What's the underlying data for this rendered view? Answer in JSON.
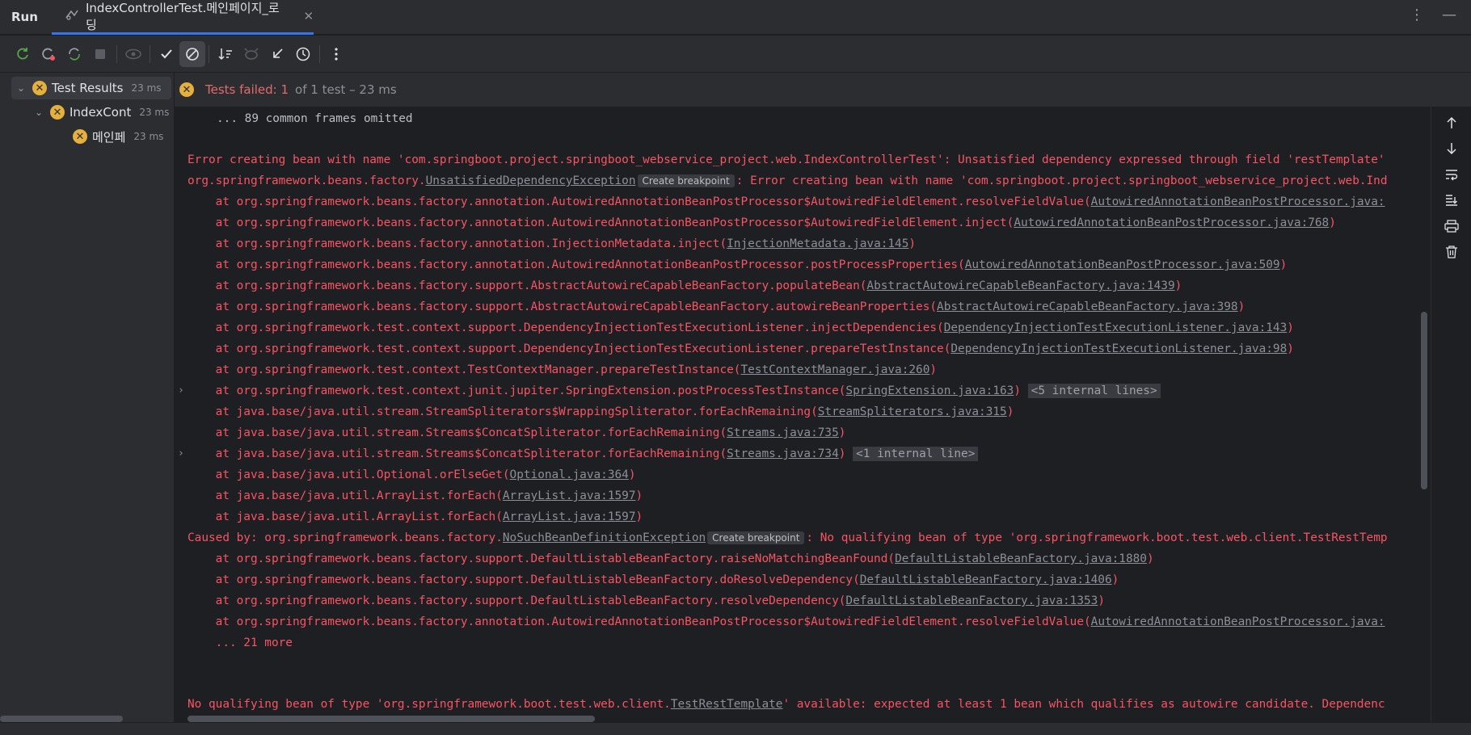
{
  "titlebar": {
    "run_label": "Run",
    "tab_title": "IndexControllerTest.메인페이지_로딩",
    "tab_close": "✕",
    "more": "⋮",
    "minimize": "—"
  },
  "tree": {
    "root": {
      "label": "Test Results",
      "duration": "23 ms"
    },
    "class_node": {
      "label": "IndexCont",
      "duration": "23 ms"
    },
    "method_node": {
      "label": "메인페",
      "duration": "23 ms"
    }
  },
  "summary": {
    "failed_label": "Tests failed: 1",
    "rest_label": "of 1 test – 23 ms"
  },
  "console": {
    "l0": "... 89 common frames omitted",
    "l1": "Error creating bean with name 'com.springboot.project.springboot_webservice_project.web.IndexControllerTest': Unsatisfied dependency expressed through field 'restTemplate'",
    "l2a": "org.springframework.beans.factory.",
    "l2link": "UnsatisfiedDependencyException",
    "l2badge": "Create breakpoint",
    "l2b": ": Error creating bean with name 'com.springboot.project.springboot_webservice_project.web.Ind",
    "l3a": "    at org.springframework.beans.factory.annotation.AutowiredAnnotationBeanPostProcessor$AutowiredFieldElement.resolveFieldValue(",
    "l3link": "AutowiredAnnotationBeanPostProcessor.java:",
    "l4a": "    at org.springframework.beans.factory.annotation.AutowiredAnnotationBeanPostProcessor$AutowiredFieldElement.inject(",
    "l4link": "AutowiredAnnotationBeanPostProcessor.java:768",
    "l5a": "    at org.springframework.beans.factory.annotation.InjectionMetadata.inject(",
    "l5link": "InjectionMetadata.java:145",
    "l6a": "    at org.springframework.beans.factory.annotation.AutowiredAnnotationBeanPostProcessor.postProcessProperties(",
    "l6link": "AutowiredAnnotationBeanPostProcessor.java:509",
    "l7a": "    at org.springframework.beans.factory.support.AbstractAutowireCapableBeanFactory.populateBean(",
    "l7link": "AbstractAutowireCapableBeanFactory.java:1439",
    "l8a": "    at org.springframework.beans.factory.support.AbstractAutowireCapableBeanFactory.autowireBeanProperties(",
    "l8link": "AbstractAutowireCapableBeanFactory.java:398",
    "l9a": "    at org.springframework.test.context.support.DependencyInjectionTestExecutionListener.injectDependencies(",
    "l9link": "DependencyInjectionTestExecutionListener.java:143",
    "l10a": "    at org.springframework.test.context.support.DependencyInjectionTestExecutionListener.prepareTestInstance(",
    "l10link": "DependencyInjectionTestExecutionListener.java:98",
    "l11a": "    at org.springframework.test.context.TestContextManager.prepareTestInstance(",
    "l11link": "TestContextManager.java:260",
    "l12a": "    at org.springframework.test.context.junit.jupiter.SpringExtension.postProcessTestInstance(",
    "l12link": "SpringExtension.java:163",
    "l12internal": "<5 internal lines>",
    "l13a": "    at java.base/java.util.stream.StreamSpliterators$WrappingSpliterator.forEachRemaining(",
    "l13link": "StreamSpliterators.java:315",
    "l14a": "    at java.base/java.util.stream.Streams$ConcatSpliterator.forEachRemaining(",
    "l14link": "Streams.java:735",
    "l15a": "    at java.base/java.util.stream.Streams$ConcatSpliterator.forEachRemaining(",
    "l15link": "Streams.java:734",
    "l15internal": "<1 internal line>",
    "l16a": "    at java.base/java.util.Optional.orElseGet(",
    "l16link": "Optional.java:364",
    "l17a": "    at java.base/java.util.ArrayList.forEach(",
    "l17link": "ArrayList.java:1597",
    "l18a": "    at java.base/java.util.ArrayList.forEach(",
    "l18link": "ArrayList.java:1597",
    "l19a": "Caused by: org.springframework.beans.factory.",
    "l19link": "NoSuchBeanDefinitionException",
    "l19badge": "Create breakpoint",
    "l19b": ": No qualifying bean of type 'org.springframework.boot.test.web.client.TestRestTemp",
    "l20a": "    at org.springframework.beans.factory.support.DefaultListableBeanFactory.raiseNoMatchingBeanFound(",
    "l20link": "DefaultListableBeanFactory.java:1880",
    "l21a": "    at org.springframework.beans.factory.support.DefaultListableBeanFactory.doResolveDependency(",
    "l21link": "DefaultListableBeanFactory.java:1406",
    "l22a": "    at org.springframework.beans.factory.support.DefaultListableBeanFactory.resolveDependency(",
    "l22link": "DefaultListableBeanFactory.java:1353",
    "l23a": "    at org.springframework.beans.factory.annotation.AutowiredAnnotationBeanPostProcessor$AutowiredFieldElement.resolveFieldValue(",
    "l23link": "AutowiredAnnotationBeanPostProcessor.java:",
    "l24": "    ... 21 more",
    "l25a": "No qualifying bean of type 'org.springframework.boot.test.web.client.",
    "l25link": "TestRestTemplate",
    "l25b": "' available: expected at least 1 bean which qualifies as autowire candidate. Dependenc",
    "close_paren": ")",
    "expander": "›"
  },
  "colors": {
    "error": "#f75464",
    "warning_badge": "#e5b03d",
    "accent": "#3574f0",
    "background": "#1e1f22",
    "panel": "#2b2d30"
  }
}
